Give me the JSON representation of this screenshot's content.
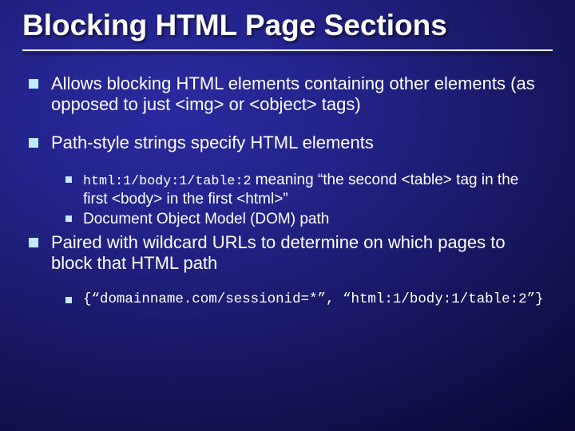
{
  "title": "Blocking HTML Page Sections",
  "bullets": [
    {
      "text": "Allows blocking HTML elements containing other elements (as opposed to just <img> or <object> tags)"
    },
    {
      "text": "Path-style strings specify HTML elements",
      "sub": [
        {
          "code": "html:1/body:1/table:2",
          "after": " meaning “the second <table> tag in the first <body> in the first <html>”"
        },
        {
          "after": "Document Object Model (DOM) path"
        }
      ]
    },
    {
      "text": "Paired with wildcard URLs to determine on which pages to block that HTML path",
      "sub": [
        {
          "codeblock": "{“domainname.com/sessionid=*”, “html:1/body:1/table:2”}"
        }
      ]
    }
  ]
}
